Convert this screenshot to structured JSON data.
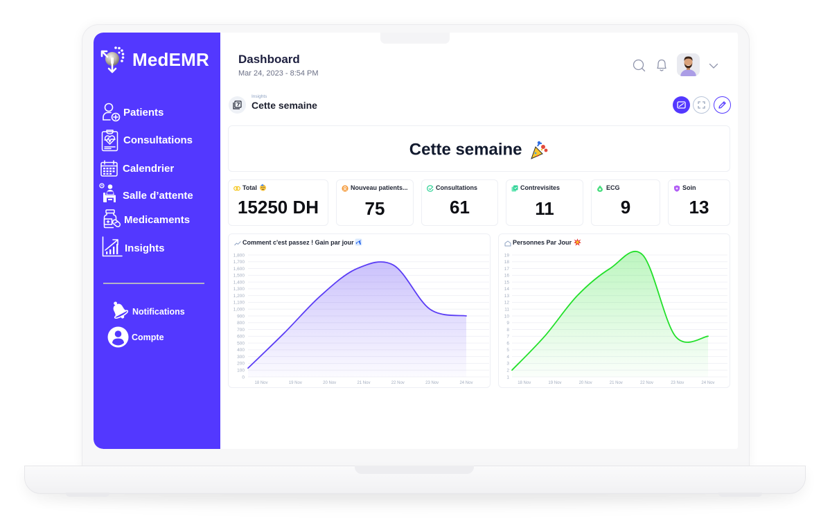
{
  "app": {
    "name": "MedEMR",
    "logo_icon": "medemr-logo-icon"
  },
  "sidebar": {
    "items": [
      {
        "label": "Patients",
        "icon": "user-plus-icon"
      },
      {
        "label": "Consultations",
        "icon": "clipboard-heart-icon"
      },
      {
        "label": "Calendrier",
        "icon": "calendar-icon"
      },
      {
        "label": "Salle d’attente",
        "icon": "waiting-room-icon"
      },
      {
        "label": "Medicaments",
        "icon": "medicine-bottle-icon"
      },
      {
        "label": "Insights",
        "icon": "chart-growth-icon"
      }
    ],
    "bottom_items": [
      {
        "label": "Notifications",
        "icon": "bell-icon"
      },
      {
        "label": "Compte",
        "icon": "user-circle-icon"
      }
    ]
  },
  "header": {
    "title": "Dashboard",
    "datetime": "Mar 24, 2023 - 8:54 PM",
    "icons": [
      "search-icon",
      "bell-icon",
      "avatar",
      "chevron-down-icon"
    ]
  },
  "insights": {
    "breadcrumb": "Insights",
    "title": "Cette semaine",
    "icon": "calendar-week-icon",
    "actions": [
      "picture-icon",
      "fullscreen-icon",
      "pencil-icon"
    ]
  },
  "banner": {
    "title": "Cette semaine",
    "emoji_icon": "party-popper"
  },
  "stats": [
    {
      "label": "Total",
      "value": "15250 DH",
      "icon": "coins-icon",
      "emoji_icon": "partying-face"
    },
    {
      "label": "Nouveau patients...",
      "value": "75",
      "icon": "new-patient-icon"
    },
    {
      "label": "Consultations",
      "value": "61",
      "icon": "check-circle-icon"
    },
    {
      "label": "Contrevisites",
      "value": "11",
      "icon": "copy-check-icon"
    },
    {
      "label": "ECG",
      "value": "9",
      "icon": "drop-icon"
    },
    {
      "label": "Soin",
      "value": "13",
      "icon": "shield-icon"
    }
  ],
  "colors": {
    "brand": "#5338FF",
    "gain_series": "#5B3DF5",
    "personnes_series": "#22E02A",
    "total_icon": "#F5C518",
    "nouveau_icon": "#F59E42",
    "consultations_icon": "#34D399",
    "contrevisites_icon": "#34D399",
    "ecg_icon": "#4ADE80",
    "soin_icon": "#B05CF5"
  },
  "chart_data": [
    {
      "type": "area",
      "title": "Comment c'est passez ! Gain par jour",
      "title_icon": "trend-line-icon",
      "title_emoji_icon": "airplane",
      "categories": [
        "18 Nov",
        "19 Nov",
        "20 Nov",
        "21 Nov",
        "22 Nov",
        "23 Nov",
        "24 Nov"
      ],
      "series": [
        {
          "name": "Gain",
          "values": [
            130,
            650,
            1200,
            1600,
            1650,
            1000,
            900
          ]
        }
      ],
      "xlabel": "",
      "ylabel": "",
      "ylim": [
        0,
        1800
      ],
      "yticks": [
        {
          "value": 0,
          "label": "0"
        },
        {
          "value": 100,
          "label": "100"
        },
        {
          "value": 200,
          "label": "200"
        },
        {
          "value": 300,
          "label": "300"
        },
        {
          "value": 400,
          "label": "400"
        },
        {
          "value": 500,
          "label": "500"
        },
        {
          "value": 600,
          "label": "600"
        },
        {
          "value": 700,
          "label": "700"
        },
        {
          "value": 800,
          "label": "800"
        },
        {
          "value": 900,
          "label": "900"
        },
        {
          "value": 1000,
          "label": "1,000"
        },
        {
          "value": 1100,
          "label": "1,100"
        },
        {
          "value": 1200,
          "label": "1,200"
        },
        {
          "value": 1300,
          "label": "1,300"
        },
        {
          "value": 1400,
          "label": "1,400"
        },
        {
          "value": 1500,
          "label": "1,500"
        },
        {
          "value": 1600,
          "label": "1,600"
        },
        {
          "value": 1700,
          "label": "1,700"
        },
        {
          "value": 1800,
          "label": "1,800"
        }
      ],
      "grid": true,
      "legend": "none",
      "color": "#5B3DF5"
    },
    {
      "type": "area",
      "title": "Personnes Par Jour",
      "title_icon": "home-icon",
      "title_emoji_icon": "collision",
      "categories": [
        "18 Nov",
        "19 Nov",
        "20 Nov",
        "21 Nov",
        "22 Nov",
        "23 Nov",
        "24 Nov"
      ],
      "series": [
        {
          "name": "Personnes",
          "values": [
            2,
            7,
            13,
            17,
            19,
            7,
            7
          ]
        }
      ],
      "xlabel": "",
      "ylabel": "",
      "ylim": [
        1,
        19
      ],
      "yticks": [
        {
          "value": 1,
          "label": "1"
        },
        {
          "value": 2,
          "label": "2"
        },
        {
          "value": 3,
          "label": "3"
        },
        {
          "value": 4,
          "label": "4"
        },
        {
          "value": 5,
          "label": "5"
        },
        {
          "value": 6,
          "label": "6"
        },
        {
          "value": 7,
          "label": "7"
        },
        {
          "value": 8,
          "label": "8"
        },
        {
          "value": 9,
          "label": "9"
        },
        {
          "value": 10,
          "label": "10"
        },
        {
          "value": 11,
          "label": "11"
        },
        {
          "value": 12,
          "label": "12"
        },
        {
          "value": 13,
          "label": "13"
        },
        {
          "value": 14,
          "label": "14"
        },
        {
          "value": 15,
          "label": "15"
        },
        {
          "value": 16,
          "label": "16"
        },
        {
          "value": 17,
          "label": "17"
        },
        {
          "value": 18,
          "label": "18"
        },
        {
          "value": 19,
          "label": "19"
        }
      ],
      "grid": true,
      "legend": "none",
      "color": "#22E02A"
    }
  ]
}
